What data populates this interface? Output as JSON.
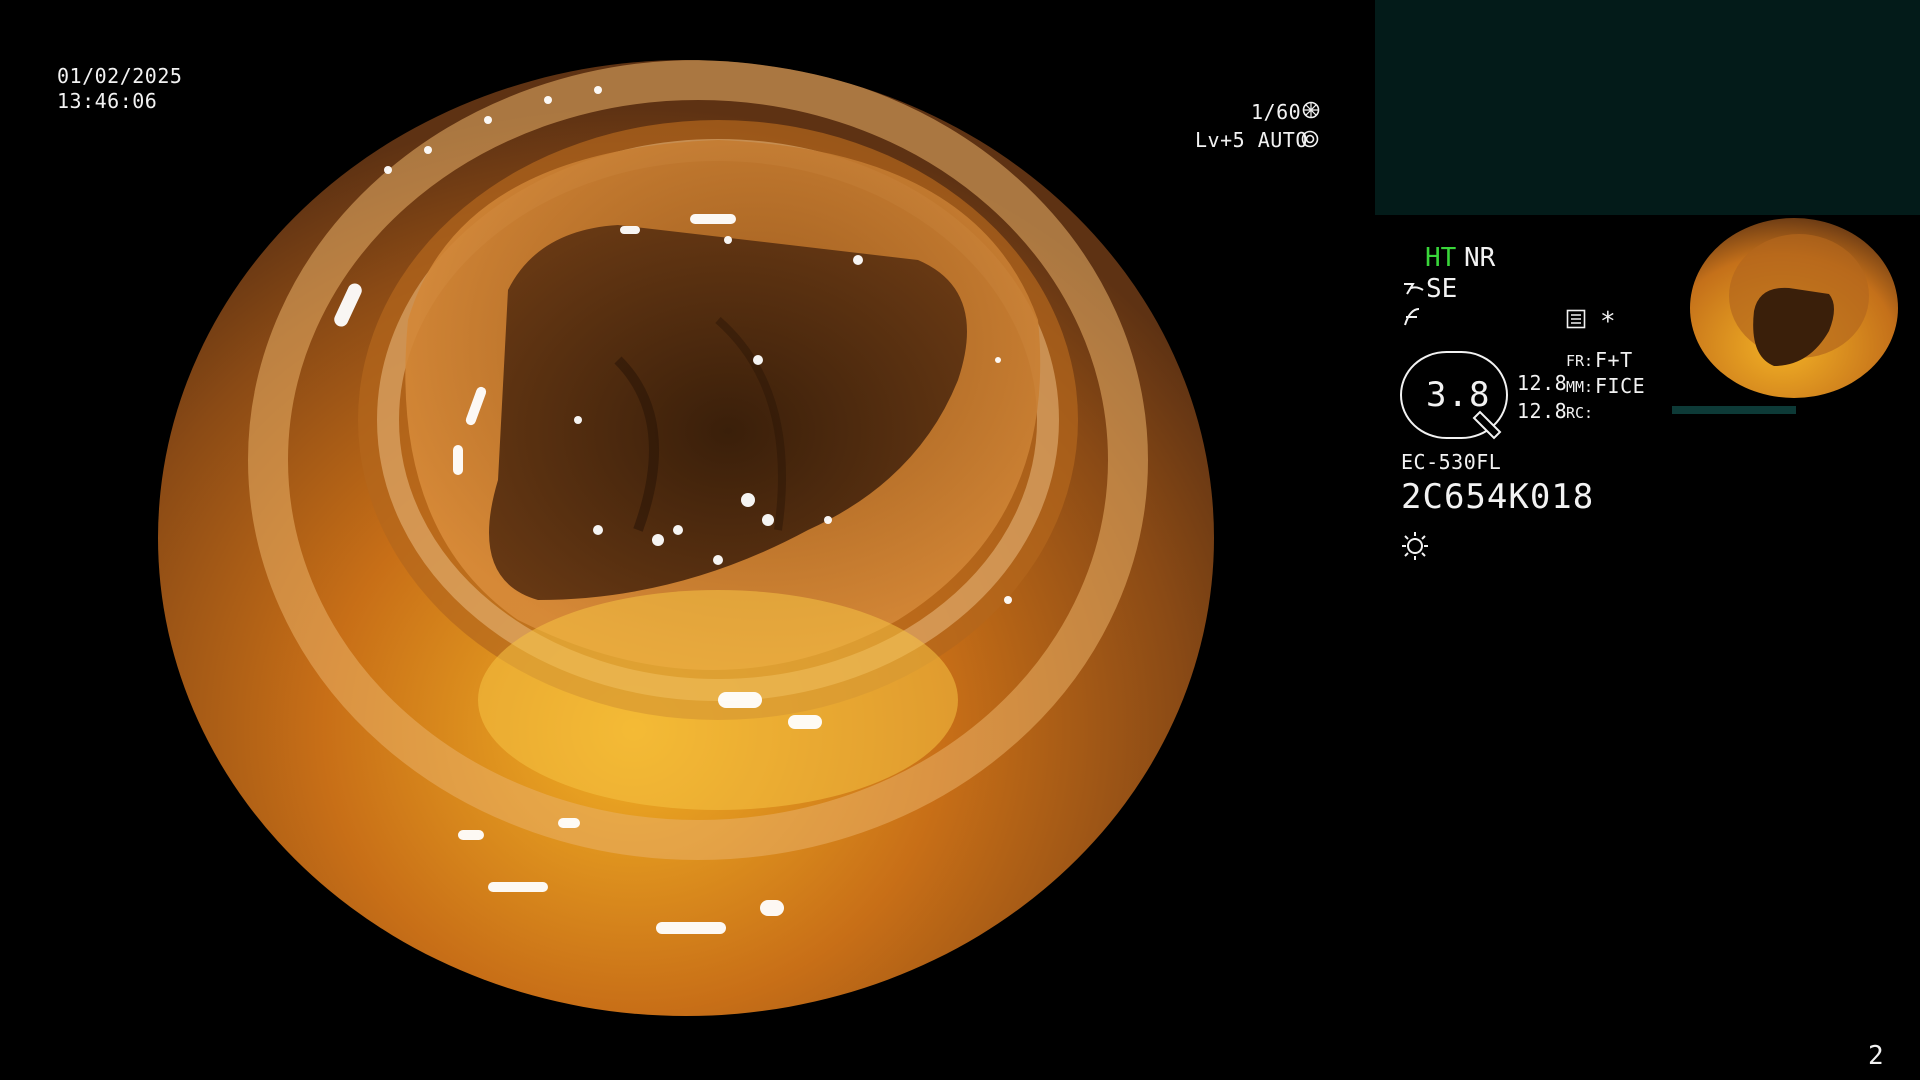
{
  "datetime": {
    "date": "01/02/2025",
    "time": "13:46:06"
  },
  "exposure": {
    "shutter": "1/60",
    "shutter_icon": "shutter-icon",
    "level": "Lv+5 AUTO",
    "iris_icon": "iris-icon"
  },
  "modes": {
    "ht": "HT",
    "nr": "NR",
    "se": "SE",
    "se_icon": "enhance-icon",
    "filter_icon": "curve-icon",
    "record_icon": "record-icon",
    "asterisk": "*"
  },
  "zoom": {
    "value": "3.8",
    "readout_top": "12.8",
    "readout_bottom": "12.8",
    "fr_label": "FR:",
    "fr_value": "F+T",
    "mm_label": "MM:",
    "mm_value": "FICE",
    "rc_label": "RC:"
  },
  "scope": {
    "model": "EC-530FL",
    "serial": "2C654K018",
    "light_icon": "light-icon"
  },
  "page_number": "2",
  "colors": {
    "accent_green": "#39d63a",
    "panel": "#031b19",
    "text": "#f2f2f2"
  }
}
